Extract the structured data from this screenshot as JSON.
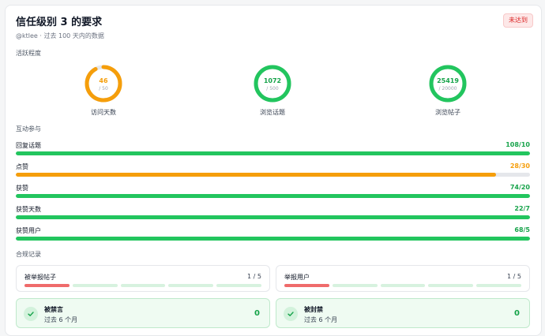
{
  "header": {
    "title": "信任级别 3 的要求",
    "status_badge": "未达到",
    "subtitle": "@ktlee · 过去 100 天内的数据"
  },
  "activity": {
    "section_label": "活跃程度",
    "donuts": [
      {
        "value": "46",
        "target": "/ 50",
        "label": "访问天数",
        "fraction": 0.92,
        "color": "#f59e0b"
      },
      {
        "value": "1072",
        "target": "/ 500",
        "label": "浏览话题",
        "fraction": 1.0,
        "color": "#22c55e"
      },
      {
        "value": "25419",
        "target": "/ 20000",
        "label": "浏览帖子",
        "fraction": 1.0,
        "color": "#22c55e"
      }
    ]
  },
  "interaction": {
    "section_label": "互动参与",
    "rows": [
      {
        "label": "回复话题",
        "value": "108/10",
        "fraction": 1.0,
        "color": "#22c55e"
      },
      {
        "label": "点赞",
        "value": "28/30",
        "fraction": 0.9333,
        "color": "#f59e0b"
      },
      {
        "label": "获赞",
        "value": "74/20",
        "fraction": 1.0,
        "color": "#22c55e"
      },
      {
        "label": "获赞天数",
        "value": "22/7",
        "fraction": 1.0,
        "color": "#22c55e"
      },
      {
        "label": "获赞用户",
        "value": "68/5",
        "fraction": 1.0,
        "color": "#22c55e"
      }
    ]
  },
  "compliance": {
    "section_label": "合规记录",
    "flagged_posts": {
      "label": "被举报帖子",
      "count": "1 / 5",
      "filled": 1,
      "total": 5
    },
    "flagged_users": {
      "label": "举报用户",
      "count": "1 / 5",
      "filled": 1,
      "total": 5
    },
    "silenced": {
      "title": "被禁言",
      "sub": "过去 6 个月",
      "value": "0"
    },
    "suspended": {
      "title": "被封禁",
      "sub": "过去 6 个月",
      "value": "0"
    }
  },
  "colors": {
    "green": "#22c55e",
    "orange": "#f59e0b",
    "red": "#ef6b6b"
  }
}
